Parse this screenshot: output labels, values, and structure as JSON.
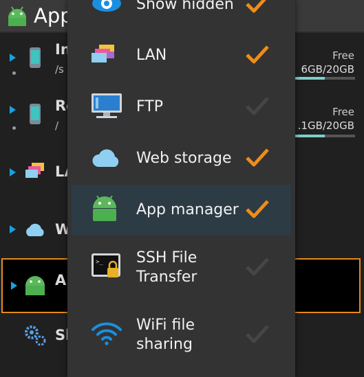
{
  "app": {
    "title": "App"
  },
  "background_rows": [
    {
      "name": "In",
      "path": "/s",
      "free_label": "Free",
      "usage": "6GB/20GB",
      "used_fraction": 0.5
    },
    {
      "name": "Ro",
      "path": "/",
      "free_label": "Free",
      "usage": ".1GB/20GB",
      "used_fraction": 0.5
    },
    {
      "name": "LA"
    },
    {
      "name": "W"
    },
    {
      "name": "Ap"
    },
    {
      "name": "Sl"
    }
  ],
  "menu": {
    "items": [
      {
        "label": "Show hidden",
        "icon": "eye-icon",
        "checked": true
      },
      {
        "label": "LAN",
        "icon": "lan-icon",
        "checked": true
      },
      {
        "label": "FTP",
        "icon": "ftp-monitor-icon",
        "checked": false
      },
      {
        "label": "Web storage",
        "icon": "cloud-icon",
        "checked": true
      },
      {
        "label": "App manager",
        "icon": "android-icon",
        "checked": true
      },
      {
        "label": "SSH File Transfer",
        "icon": "ssh-terminal-icon",
        "checked": false
      },
      {
        "label": "WiFi file sharing",
        "icon": "wifi-icon",
        "checked": false
      }
    ]
  },
  "colors": {
    "accent": "#f08c1a",
    "check_off": "#4a4a4a",
    "highlight": "#2c3b44",
    "selection_border": "#e58a1f"
  }
}
